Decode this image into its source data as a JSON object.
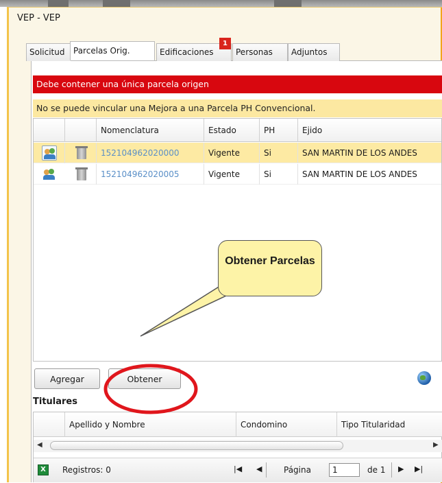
{
  "window": {
    "title": "VEP - VEP"
  },
  "tabs": [
    {
      "label": "Solicitud"
    },
    {
      "label": "Parcelas Orig."
    },
    {
      "label": "Edificaciones"
    },
    {
      "label": "Personas"
    },
    {
      "label": "Adjuntos"
    }
  ],
  "badge": {
    "count": "1"
  },
  "messages": {
    "error": "Debe contener una única parcela origen",
    "warning": "No se puede vincular una Mejora a una Parcela PH Convencional."
  },
  "grid": {
    "columns": [
      "Nomenclatura",
      "Estado",
      "PH",
      "Ejido"
    ],
    "rows": [
      {
        "nomenclatura": "152104962020000",
        "estado": "Vigente",
        "ph": "Si",
        "ejido": "SAN MARTIN DE LOS ANDES",
        "selected": true
      },
      {
        "nomenclatura": "152104962020005",
        "estado": "Vigente",
        "ph": "Si",
        "ejido": "SAN MARTIN DE LOS ANDES",
        "selected": false
      }
    ]
  },
  "toolbar": {
    "add_label": "Agregar",
    "get_label": "Obtener",
    "globe_icon": "globe-icon"
  },
  "titulares": {
    "title": "Titulares",
    "columns": [
      "Apellido y Nombre",
      "Condomino",
      "Tipo Titularidad"
    ],
    "records_label": "Registros: 0",
    "page_label": "Página",
    "page_value": "1",
    "of_label": "de 1"
  },
  "callout": {
    "text": "Obtener Parcelas"
  },
  "colors": {
    "error_bg": "#d8070f",
    "warning_bg": "#fce8a1",
    "selected_row": "#fdeaa3",
    "accent": "#f2a41c",
    "annotation": "#e0161c"
  }
}
